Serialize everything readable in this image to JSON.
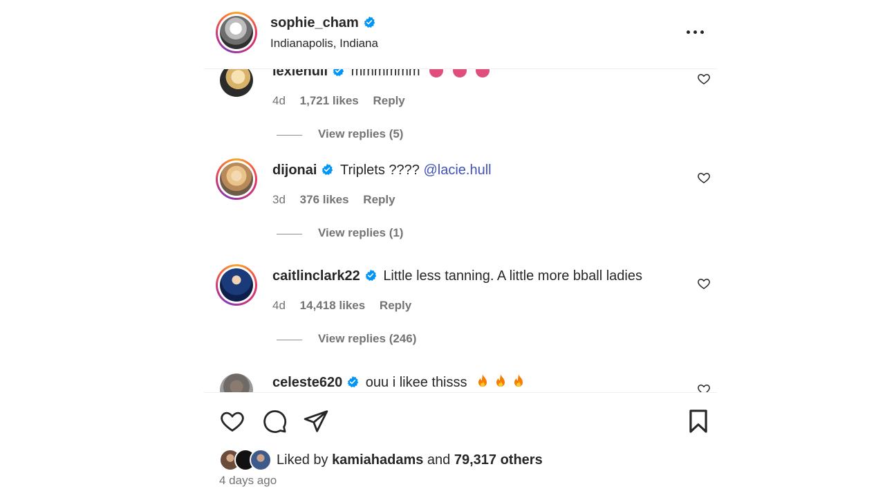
{
  "post": {
    "username": "sophie_cham",
    "location": "Indianapolis, Indiana",
    "more_icon": "more-horizontal-icon"
  },
  "comments": [
    {
      "username": "lexiehull",
      "text": "mmmmmm",
      "time": "4d",
      "likes": "1,721 likes",
      "reply": "Reply",
      "view_replies": "View replies (5)",
      "verified": true
    },
    {
      "username": "dijonai",
      "text": "Triplets ????",
      "mention": "@lacie.hull",
      "time": "3d",
      "likes": "376 likes",
      "reply": "Reply",
      "view_replies": "View replies (1)",
      "verified": true
    },
    {
      "username": "caitlinclark22",
      "text": "Little less tanning. A little more bball ladies",
      "time": "4d",
      "likes": "14,418 likes",
      "reply": "Reply",
      "view_replies": "View replies (246)",
      "verified": true
    },
    {
      "username": "celeste620",
      "text": "ouu i likee thisss",
      "verified": true
    }
  ],
  "liked_by": {
    "prefix": "Liked by",
    "user": "kamiahadams",
    "conjunction": "and",
    "others": "79,317 others"
  },
  "timestamp": "4 days ago",
  "colors": {
    "verified": "#0095f6",
    "mention": "#3f51b5",
    "secondary_text": "#737373"
  }
}
